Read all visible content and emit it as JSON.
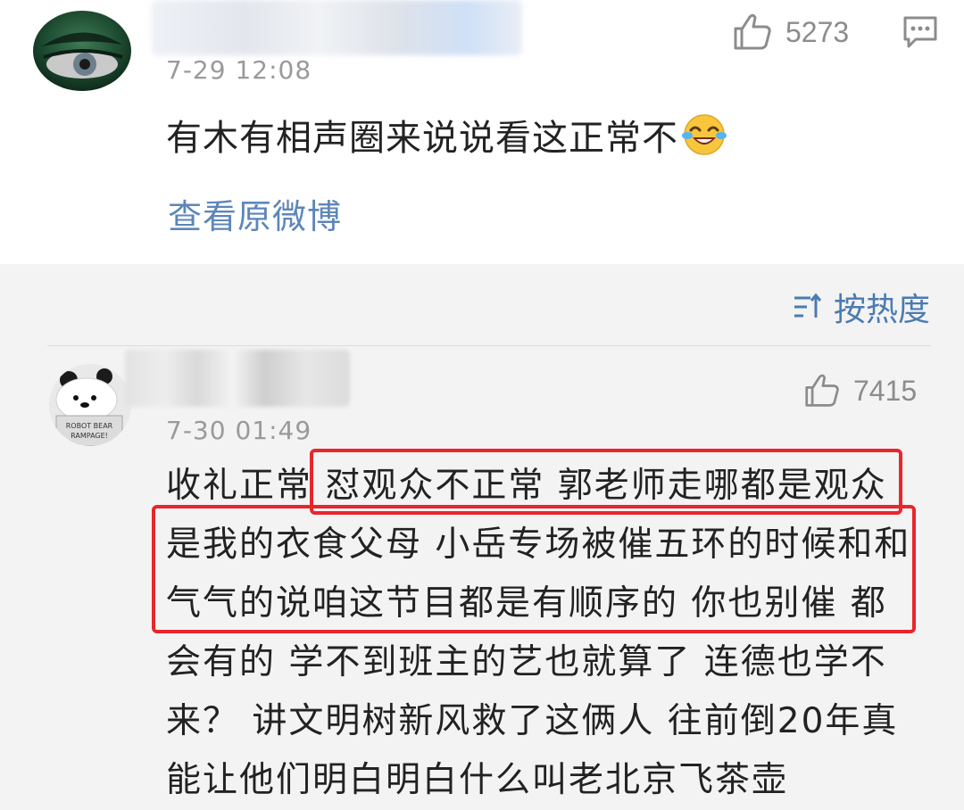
{
  "post": {
    "date_time": "7-29 12:08",
    "likes": "5273",
    "text": "有木有相声圈来说说看这正常不",
    "emoji": "laughing-crying-emoji",
    "view_original": "查看原微博"
  },
  "sort": {
    "label": "按热度"
  },
  "comment": {
    "date_time": "7-30 01:49",
    "likes": "7415",
    "avatar_text_1": "ROBOT BEAR",
    "avatar_text_2": "RAMPAGE!",
    "lines": [
      "收礼正常  怼观众不正常  郭老师走哪都是观众",
      "是我的衣食父母  小岳专场被催五环的时候和和",
      "气气的说咱这节目都是有顺序的  你也别催  都",
      "会有的  学不到班主的艺也就算了  连德也学不",
      "来？  讲文明树新风救了这俩人  往前倒20年真",
      "能让他们明白明白什么叫老北京飞茶壶"
    ]
  },
  "colors": {
    "link": "#5d86b8",
    "sort": "#4b7bb1",
    "highlight": "#e8262c",
    "background": "#f3f3f3"
  }
}
